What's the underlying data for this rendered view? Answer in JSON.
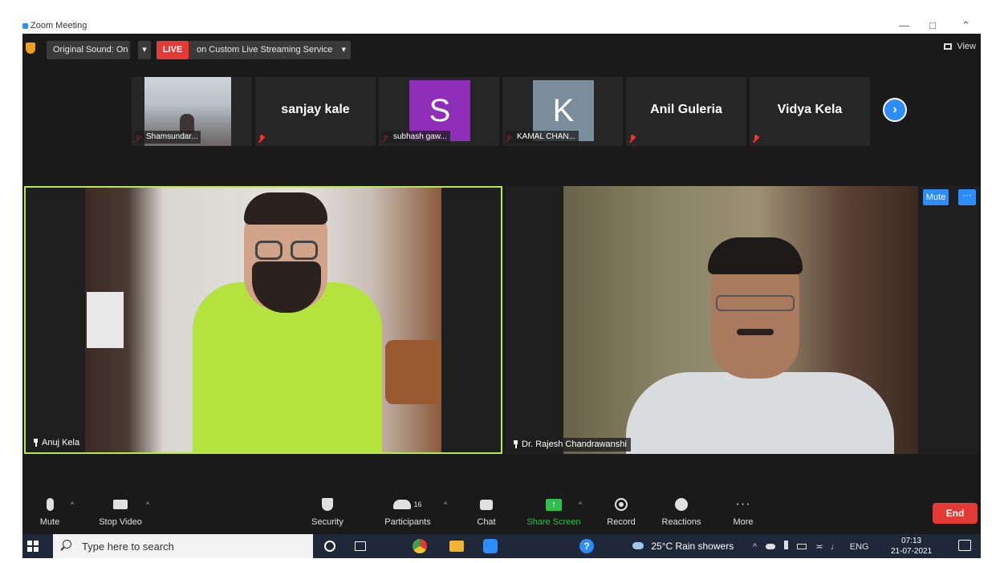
{
  "window": {
    "title": "Zoom Meeting"
  },
  "topbar": {
    "original_sound": "Original Sound: On",
    "live_badge": "LIVE",
    "streaming": "on Custom Live Streaming Service",
    "view": "View"
  },
  "thumbnails": [
    {
      "kind": "video",
      "label": "Shamsundar..."
    },
    {
      "kind": "name",
      "name": "sanjay kale"
    },
    {
      "kind": "avatar",
      "initial": "S",
      "color": "#8e2db8",
      "label": "subhash gaw..."
    },
    {
      "kind": "avatar",
      "initial": "K",
      "color": "#7a8d9a",
      "label": "KAMAL CHAN..."
    },
    {
      "kind": "name",
      "name": "Anil Guleria"
    },
    {
      "kind": "name",
      "name": "Vidya Kela"
    }
  ],
  "videos": {
    "left_name": "Anuj Kela",
    "right_name": "Dr. Rajesh Chandrawanshi",
    "mute_label": "Mute",
    "more_label": "···"
  },
  "toolbar": {
    "mute": "Mute",
    "stop_video": "Stop Video",
    "security": "Security",
    "participants": "Participants",
    "participants_count": "16",
    "chat": "Chat",
    "share_screen": "Share Screen",
    "record": "Record",
    "reactions": "Reactions",
    "more": "More",
    "end": "End"
  },
  "taskbar": {
    "search_placeholder": "Type here to search",
    "weather": "25°C  Rain showers",
    "lang": "ENG",
    "time": "07:13",
    "date": "21-07-2021"
  },
  "colors": {
    "zoom_blue": "#2d8cff",
    "live_red": "#e53935",
    "active_speaker": "#b6e84a",
    "share_green": "#2ebd4e"
  }
}
